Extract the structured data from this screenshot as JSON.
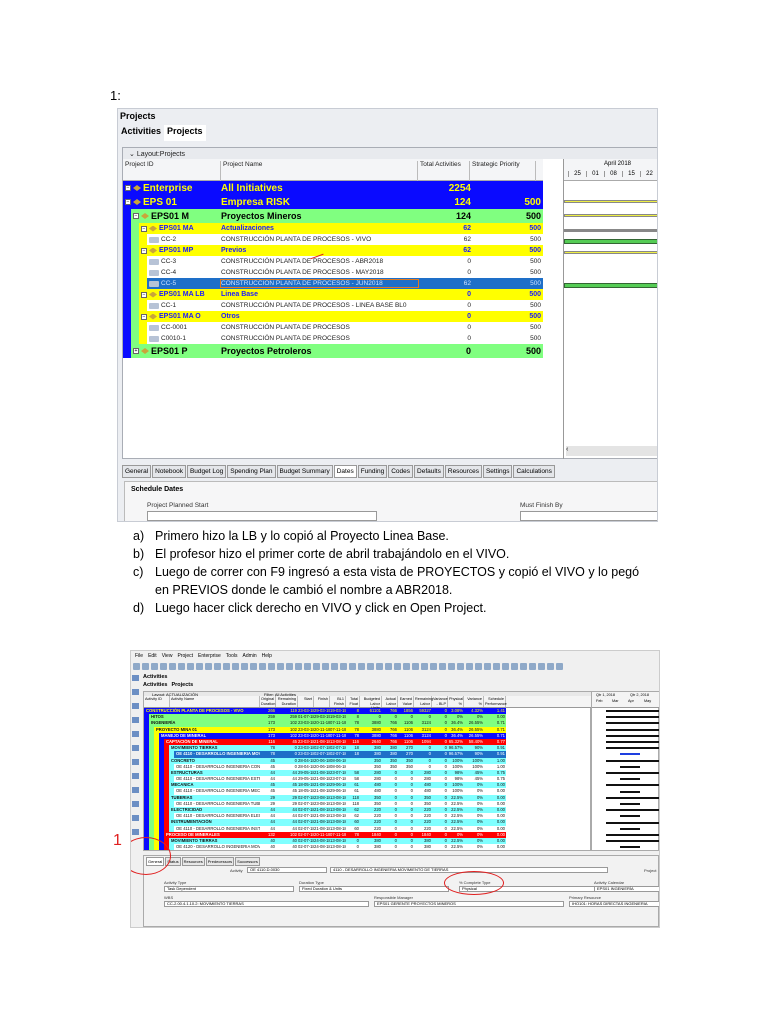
{
  "page_number": "1:",
  "shot1": {
    "window_title": "Projects",
    "tabs": [
      "Activities",
      "Projects"
    ],
    "layout": "Layout:Projects",
    "headers": {
      "id": "Project ID",
      "name": "Project Name",
      "total": "Total Activities",
      "priority": "Strategic Priority"
    },
    "gantt": {
      "month": "April 2018",
      "weeks": [
        "25",
        "01",
        "08",
        "15",
        "22"
      ]
    },
    "rows": [
      {
        "level": 0,
        "kind": "eps-top",
        "id": "Enterprise",
        "name": "All  Initiatives",
        "total": "2254",
        "priority": ""
      },
      {
        "level": 0,
        "kind": "eps-top",
        "id": "EPS 01",
        "name": "Empresa RISK",
        "total": "124",
        "priority": "500"
      },
      {
        "level": 1,
        "kind": "eps-green",
        "id": "EPS01 M",
        "name": "Proyectos Mineros",
        "total": "124",
        "priority": "500"
      },
      {
        "level": 2,
        "kind": "eps-yellow",
        "id": "EPS01 MA",
        "name": "Actualizaciones",
        "total": "62",
        "priority": "500"
      },
      {
        "level": 3,
        "kind": "project",
        "id": "CC-2",
        "name": "CONSTRUCCIÓN PLANTA DE PROCESOS - VIVO",
        "total": "62",
        "priority": "500"
      },
      {
        "level": 2,
        "kind": "eps-yellow",
        "id": "EPS01 MP",
        "name": "Previos",
        "total": "62",
        "priority": "500"
      },
      {
        "level": 3,
        "kind": "project",
        "id": "CC-3",
        "name": "CONSTRUCCIÓN PLANTA DE PROCESOS - ABR2018",
        "total": "0",
        "priority": "500"
      },
      {
        "level": 3,
        "kind": "project",
        "id": "CC-4",
        "name": "CONSTRUCCIÓN PLANTA DE PROCESOS - MAY2018",
        "total": "0",
        "priority": "500"
      },
      {
        "level": 3,
        "kind": "selected",
        "id": "CC-5",
        "name": "CONSTRUCCIÓN PLANTA DE PROCESOS - JUN2018",
        "total": "62",
        "priority": "500"
      },
      {
        "level": 2,
        "kind": "eps-yellow",
        "id": "EPS01 MA LB",
        "name": "Linea Base",
        "total": "0",
        "priority": "500"
      },
      {
        "level": 3,
        "kind": "project",
        "id": "CC-1",
        "name": "CONSTRUCCIÓN PLANTA DE PROCESOS - LINEA BASE BL0",
        "total": "0",
        "priority": "500"
      },
      {
        "level": 2,
        "kind": "eps-yellow",
        "id": "EPS01 MA O",
        "name": "Otros",
        "total": "0",
        "priority": "500"
      },
      {
        "level": 3,
        "kind": "project",
        "id": "CC-0001",
        "name": "CONSTRUCCIÓN PLANTA DE PROCESOS",
        "total": "0",
        "priority": "500"
      },
      {
        "level": 3,
        "kind": "project",
        "id": "C0010-1",
        "name": "CONSTRUCCIÓN PLANTA DE PROCESOS",
        "total": "0",
        "priority": "500"
      },
      {
        "level": 1,
        "kind": "eps-green",
        "id": "EPS01 P",
        "name": "Proyectos Petroleros",
        "total": "0",
        "priority": "500"
      }
    ],
    "bottom_tabs": [
      "General",
      "Notebook",
      "Budget Log",
      "Spending Plan",
      "Budget Summary",
      "Dates",
      "Funding",
      "Codes",
      "Defaults",
      "Resources",
      "Settings",
      "Calculations"
    ],
    "active_bottom_tab": "Dates",
    "schedule_dates": {
      "title": "Schedule Dates",
      "planned_start_label": "Project Planned Start",
      "must_finish_label": "Must Finish By"
    }
  },
  "steps": [
    {
      "marker": "a)",
      "text": "Primero hizo la LB y lo copió al Proyecto Linea Base."
    },
    {
      "marker": "b)",
      "text": "El profesor hizo el primer corte de abril trabajándolo en el VIVO."
    },
    {
      "marker": "c)",
      "text": "Luego de correr con F9 ingresó a esta vista de PROYECTOS y copió el VIVO y lo pegó en PREVIOS donde le cambió el nombre a ABR2018."
    },
    {
      "marker": "d)",
      "text": "Luego hacer click derecho en VIVO y click en Open Project."
    }
  ],
  "shot2": {
    "menu": [
      "File",
      "Edit",
      "View",
      "Project",
      "Enterprise",
      "Tools",
      "Admin",
      "Help"
    ],
    "title": "Activities",
    "tabs": [
      "Activities",
      "Projects"
    ],
    "layout": "Layout: ACTUALIZACIÓN",
    "filter": "Filter: All Activities",
    "headers": [
      "Activity ID",
      "Activity Name",
      "Original Duration",
      "Remaining Duration",
      "Start",
      "Finish",
      "BL1 Finish",
      "Total Float",
      "Budgeted Labor Units",
      "Actual Labor",
      "Earned Value",
      "Remaining Labor",
      "Variance - BLP",
      "Physical %",
      "Variance %",
      "Schedule Performance"
    ],
    "gantt_header": [
      "Qtr 1, 2018",
      "Qtr 2, 2018",
      "Feb",
      "Mar",
      "Apr",
      "May"
    ],
    "rows": [
      {
        "lvl": 0,
        "c": "blue",
        "name": "CONSTRUCCIÓN PLANTA DE PROCESOS - VIVO",
        "v": [
          "266",
          "119",
          "23-03-18",
          "29-03-19",
          "19-03-19",
          "8",
          "61101",
          "766",
          "1856",
          "59327",
          "0",
          "3.08%",
          "4.32%",
          "1.41"
        ]
      },
      {
        "lvl": 1,
        "c": "green",
        "name": "HITOS",
        "v": [
          "259",
          "259",
          "01-07-18",
          "29-03-19",
          "19-03-19",
          "8",
          "0",
          "0",
          "0",
          "0",
          "0",
          "0%",
          "0%",
          "0.00"
        ]
      },
      {
        "lvl": 1,
        "c": "green",
        "name": "INGENIERÍA",
        "v": [
          "173",
          "102",
          "23-03-18",
          "20-11-18",
          "07-11-18",
          "78",
          "3880",
          "766",
          "1106",
          "3124",
          "0",
          "36.4%",
          "26.55%",
          "0.71"
        ]
      },
      {
        "lvl": 2,
        "c": "yellow",
        "name": "PROYECTO MINA 01",
        "v": [
          "173",
          "102",
          "23-03-18",
          "20-11-18",
          "07-11-18",
          "78",
          "3880",
          "766",
          "1106",
          "3124",
          "0",
          "36.4%",
          "26.55%",
          "0.71"
        ]
      },
      {
        "lvl": 3,
        "c": "blue",
        "name": "MANEJO DE MINERAL",
        "v": [
          "173",
          "102",
          "23-03-18",
          "20-11-18",
          "07-11-18",
          "78",
          "3880",
          "766",
          "1106",
          "3124",
          "0",
          "36.4%",
          "26.55%",
          "0.71"
        ]
      },
      {
        "lvl": 4,
        "c": "red",
        "name": "CAPTACIÓN DE MINERAL",
        "v": [
          "116",
          "45",
          "23-03-18",
          "21-08-18",
          "13-08-18",
          "116",
          "2640",
          "766",
          "1106",
          "1094",
          "0",
          "65.32%",
          "58.40%",
          "0.77"
        ]
      },
      {
        "lvl": 5,
        "c": "cyan",
        "name": "MOVIMIENTO TIERRAS",
        "v": [
          "78",
          "0",
          "23-03-18",
          "02-07-18",
          "02-07-18",
          "18",
          "380",
          "380",
          "270",
          "0",
          "0",
          "96.57%",
          "90%",
          "0.91"
        ]
      },
      {
        "lvl": 6,
        "c": "sel",
        "name": "OE 4110 - DESARROLLO INGENIERIA MOVIMIENTO DE TIERRAS",
        "v": [
          "78",
          "0",
          "23-03-18",
          "02-07-18",
          "02-07-18",
          "18",
          "380",
          "380",
          "270",
          "0",
          "0",
          "96.57%",
          "90%",
          "0.91"
        ]
      },
      {
        "lvl": 5,
        "c": "cyan",
        "name": "CONCRETO",
        "v": [
          "45",
          "0",
          "28-04-18",
          "20-06-18",
          "08-06-18",
          "",
          "350",
          "350",
          "350",
          "0",
          "0",
          "100%",
          "100%",
          "1.00"
        ]
      },
      {
        "lvl": 6,
        "c": "white",
        "name": "OE 4110 - DESARROLLO INGENIERIA CONCRETO",
        "v": [
          "45",
          "0",
          "28-04-18",
          "20-06-18",
          "08-06-18",
          "",
          "350",
          "350",
          "350",
          "0",
          "0",
          "100%",
          "100%",
          "1.00"
        ]
      },
      {
        "lvl": 5,
        "c": "cyan",
        "name": "ESTRUCTURAS",
        "v": [
          "44",
          "44",
          "29-05-18",
          "21-08-18",
          "23-07-18",
          "58",
          "280",
          "0",
          "0",
          "280",
          "0",
          "98%",
          "45%",
          "0.75"
        ]
      },
      {
        "lvl": 6,
        "c": "white",
        "name": "OE 4110 - DESARROLLO INGENIERIA ESTRUCTURAS",
        "v": [
          "44",
          "44",
          "29-05-18",
          "21-08-18",
          "23-07-18",
          "58",
          "280",
          "0",
          "0",
          "280",
          "0",
          "98%",
          "45%",
          "0.75"
        ]
      },
      {
        "lvl": 5,
        "c": "cyan",
        "name": "MECANICA",
        "v": [
          "45",
          "45",
          "18-05-18",
          "21-08-18",
          "29-06-18",
          "61",
          "480",
          "0",
          "0",
          "480",
          "0",
          "100%",
          "0%",
          "0.00"
        ]
      },
      {
        "lvl": 6,
        "c": "white",
        "name": "OE 4110 - DESARROLLO INGENIERIA MECANICA",
        "v": [
          "45",
          "45",
          "18-05-18",
          "21-08-18",
          "29-06-18",
          "61",
          "480",
          "0",
          "0",
          "480",
          "0",
          "100%",
          "0%",
          "0.00"
        ]
      },
      {
        "lvl": 5,
        "c": "cyan",
        "name": "TUBERIAS",
        "v": [
          "29",
          "29",
          "02-07-18",
          "23-08-18",
          "13-08-18",
          "118",
          "350",
          "0",
          "0",
          "350",
          "0",
          "22.5%",
          "0%",
          "0.00"
        ]
      },
      {
        "lvl": 6,
        "c": "white",
        "name": "OE 4110 - DESARROLLO INGENIERIA TUBERIAS",
        "v": [
          "29",
          "29",
          "02-07-18",
          "23-08-18",
          "13-08-18",
          "118",
          "350",
          "0",
          "0",
          "350",
          "0",
          "22.5%",
          "0%",
          "0.00"
        ]
      },
      {
        "lvl": 5,
        "c": "cyan",
        "name": "ELECTRICIDAD",
        "v": [
          "44",
          "44",
          "02-07-18",
          "21-08-18",
          "13-08-18",
          "62",
          "220",
          "0",
          "0",
          "220",
          "0",
          "22.5%",
          "0%",
          "0.00"
        ]
      },
      {
        "lvl": 6,
        "c": "white",
        "name": "OE 4110 - DESARROLLO INGENIERIA ELECTRICIDAD",
        "v": [
          "44",
          "44",
          "02-07-18",
          "21-08-18",
          "13-08-18",
          "62",
          "220",
          "0",
          "0",
          "220",
          "0",
          "22.5%",
          "0%",
          "0.00"
        ]
      },
      {
        "lvl": 5,
        "c": "cyan",
        "name": "INSTRUMENTACIÓN",
        "v": [
          "44",
          "44",
          "02-07-18",
          "21-08-18",
          "13-08-18",
          "60",
          "220",
          "0",
          "0",
          "220",
          "0",
          "22.5%",
          "0%",
          "0.00"
        ]
      },
      {
        "lvl": 6,
        "c": "white",
        "name": "OE 4110 - DESARROLLO INGENIERIA INSTRUMENTACION",
        "v": [
          "44",
          "44",
          "02-07-18",
          "21-08-18",
          "13-08-18",
          "60",
          "220",
          "0",
          "0",
          "220",
          "0",
          "22.5%",
          "0%",
          "0.00"
        ]
      },
      {
        "lvl": 4,
        "c": "red",
        "name": "PROCESO DE MINERALES",
        "v": [
          "132",
          "102",
          "02-07-18",
          "20-11-18",
          "07-11-18",
          "78",
          "1840",
          "0",
          "0",
          "1840",
          "0",
          "0%",
          "0%",
          "0.00"
        ]
      },
      {
        "lvl": 5,
        "c": "cyan",
        "name": "MOVIMIENTO TIERRAS",
        "v": [
          "40",
          "40",
          "02-07-18",
          "24-08-18",
          "13-08-18",
          "0",
          "380",
          "0",
          "0",
          "380",
          "0",
          "22.5%",
          "0%",
          "0.00"
        ]
      },
      {
        "lvl": 6,
        "c": "white",
        "name": "OE 4120 - DESARROLLO INGENIERIA MOVIMIENTO DE TIERRAS",
        "v": [
          "40",
          "40",
          "02-07-18",
          "24-08-18",
          "13-08-18",
          "0",
          "380",
          "0",
          "0",
          "380",
          "0",
          "22.5%",
          "0%",
          "0.00"
        ]
      }
    ],
    "detail_tabs": [
      "General",
      "Status",
      "Resources",
      "Predecessors",
      "Successors"
    ],
    "detail": {
      "activity_label": "Activity",
      "activity_id": "OE 4110.D.0030",
      "activity_name": "4110 - DESARROLLO INGENIERIA MOVIMIENTO DE TIERRAS",
      "project_label": "Project",
      "activity_type_label": "Activity Type",
      "activity_type": "Task Dependent",
      "duration_type_label": "Duration Type",
      "duration_type": "Fixed Duration & Units",
      "complete_type_label": "% Complete Type",
      "complete_type": "Physical",
      "calendar_label": "Activity Calendar",
      "calendar": "EPS01 INGENIERÍA",
      "wbs_label": "WBS",
      "wbs": "CC-2.00.4.1.10.2: MOVIMIENTO TIERRAS",
      "manager_label": "Responsible Manager",
      "manager": "EPS01 GERENTE PROYECTOS MINEROS",
      "resource_label": "Primary Resource",
      "resource": "IHO101: HORAS DIRECTAS INGENIERIA"
    }
  },
  "colors": {
    "blue": "#0a0aff",
    "green": "#80ff80",
    "yellow": "#ffff00",
    "red": "#ff0000",
    "cyan": "#80ffff",
    "selected": "#1e6fc8",
    "annot": "#e02020"
  }
}
